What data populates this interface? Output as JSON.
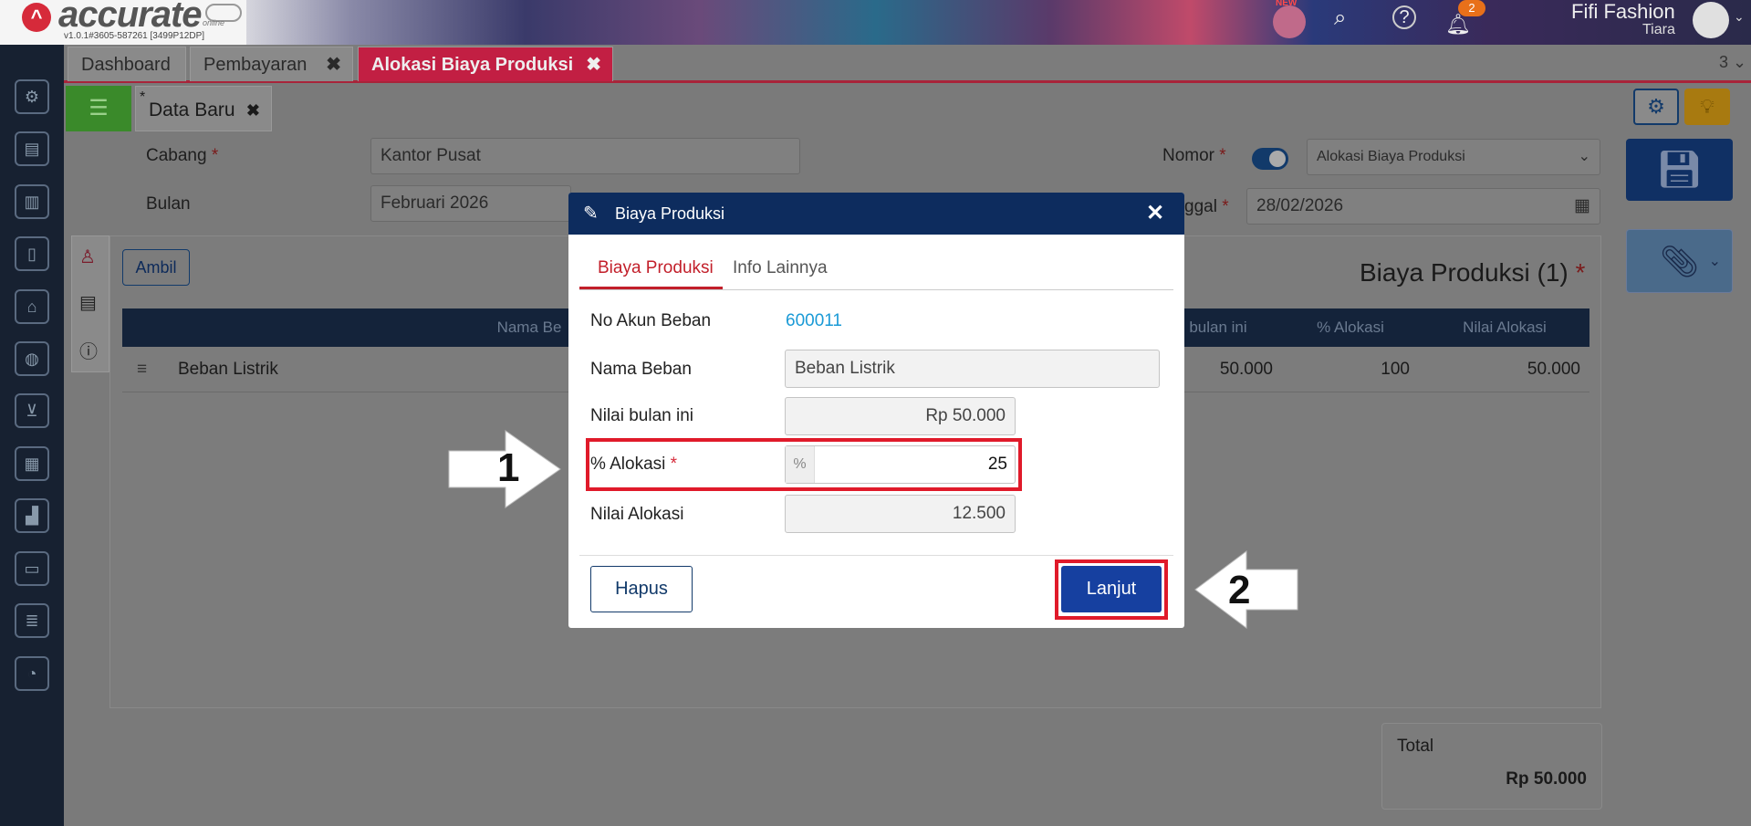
{
  "app": {
    "brand": "accurate",
    "brand_sub": "online",
    "version": "v1.0.1#3605-587261 [3499P12DP]",
    "new_badge": "NEW",
    "notif_count": "2",
    "company": "Fifi Fashion",
    "user": "Tiara"
  },
  "tabs": [
    {
      "label": "Dashboard"
    },
    {
      "label": "Pembayaran",
      "close": "✖"
    },
    {
      "label": "Alokasi Biaya Produksi",
      "close": "✖"
    }
  ],
  "tab_count": "3 ⌄",
  "subtab": {
    "label": "Data Baru",
    "marker": "*",
    "close": "✖"
  },
  "form": {
    "cabang_label": "Cabang",
    "cabang_value": "Kantor Pusat",
    "bulan_label": "Bulan",
    "bulan_value": "Februari 2026",
    "nomor_label": "Nomor",
    "nomor_value": "Alokasi Biaya Produksi",
    "tanggal_label": "ggal",
    "tanggal_value": "28/02/2026",
    "required_mark": "*"
  },
  "grid": {
    "ambil_label": "Ambil",
    "title": "Biaya Produksi (1)",
    "headers": [
      "Nama Be",
      "bulan ini",
      "% Alokasi",
      "Nilai Alokasi"
    ],
    "row": {
      "nama": "Beban Listrik",
      "nilai": "50.000",
      "alokasi": "100",
      "nilai_alokasi": "50.000"
    }
  },
  "total": {
    "label": "Total",
    "value": "Rp 50.000"
  },
  "modal": {
    "title": "Biaya Produksi",
    "tabs": [
      "Biaya Produksi",
      "Info Lainnya"
    ],
    "no_akun_label": "No Akun Beban",
    "no_akun_value": "600011",
    "nama_label": "Nama Beban",
    "nama_value": "Beban Listrik",
    "nilai_label": "Nilai bulan ini",
    "nilai_value": "Rp 50.000",
    "alokasi_label": "% Alokasi",
    "alokasi_prefix": "%",
    "alokasi_value": "25",
    "nilai_alokasi_label": "Nilai Alokasi",
    "nilai_alokasi_value": "12.500",
    "hapus_label": "Hapus",
    "lanjut_label": "Lanjut"
  },
  "annotations": {
    "step1": "1",
    "step2": "2"
  },
  "colors": {
    "accent": "#c21f43",
    "navy": "#0d2c5e",
    "primary_button": "#1640a0",
    "highlight": "#e01a2a",
    "link": "#1a9ad6"
  }
}
